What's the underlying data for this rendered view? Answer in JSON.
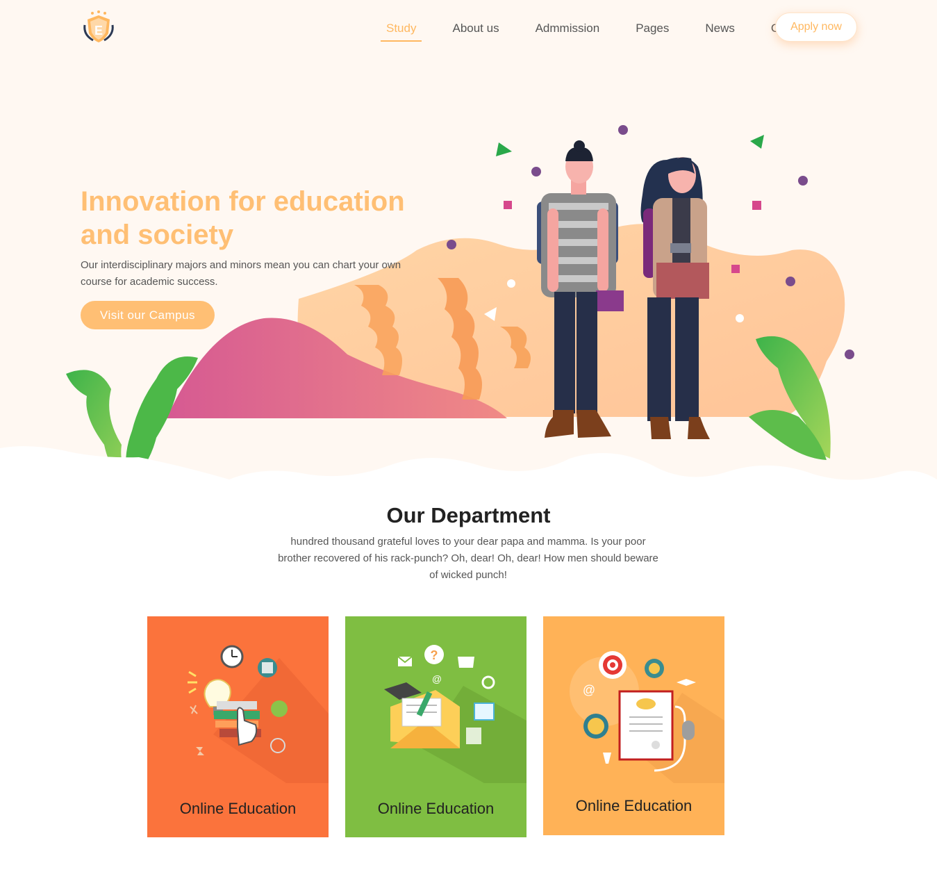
{
  "header": {
    "logo_letter": "E",
    "nav": [
      {
        "label": "Study",
        "active": true
      },
      {
        "label": "About us",
        "active": false
      },
      {
        "label": "Admmission",
        "active": false
      },
      {
        "label": "Pages",
        "active": false
      },
      {
        "label": "News",
        "active": false
      },
      {
        "label": "Contact",
        "active": false
      }
    ],
    "apply_label": "Apply now"
  },
  "hero": {
    "title": "Innovation for education and society",
    "text": "Our interdisciplinary majors and minors mean you can chart your own course for academic success.",
    "cta_label": "Visit our Campus"
  },
  "department": {
    "title": "Our Department",
    "text": "hundred thousand grateful loves to your dear papa and mamma. Is your poor brother recovered of his rack-punch? Oh, dear! Oh, dear! How men should beware of wicked punch!",
    "cards": [
      {
        "label": "Online Education",
        "color": "#fb733c",
        "icon": "education-tools-icon"
      },
      {
        "label": "Online Education",
        "color": "#7fbe42",
        "icon": "study-envelope-icon"
      },
      {
        "label": "Online Education",
        "color": "#ffb257",
        "icon": "certificate-target-icon"
      }
    ]
  },
  "colors": {
    "accent": "#ffb860",
    "hero_bg": "#fff8f2"
  }
}
